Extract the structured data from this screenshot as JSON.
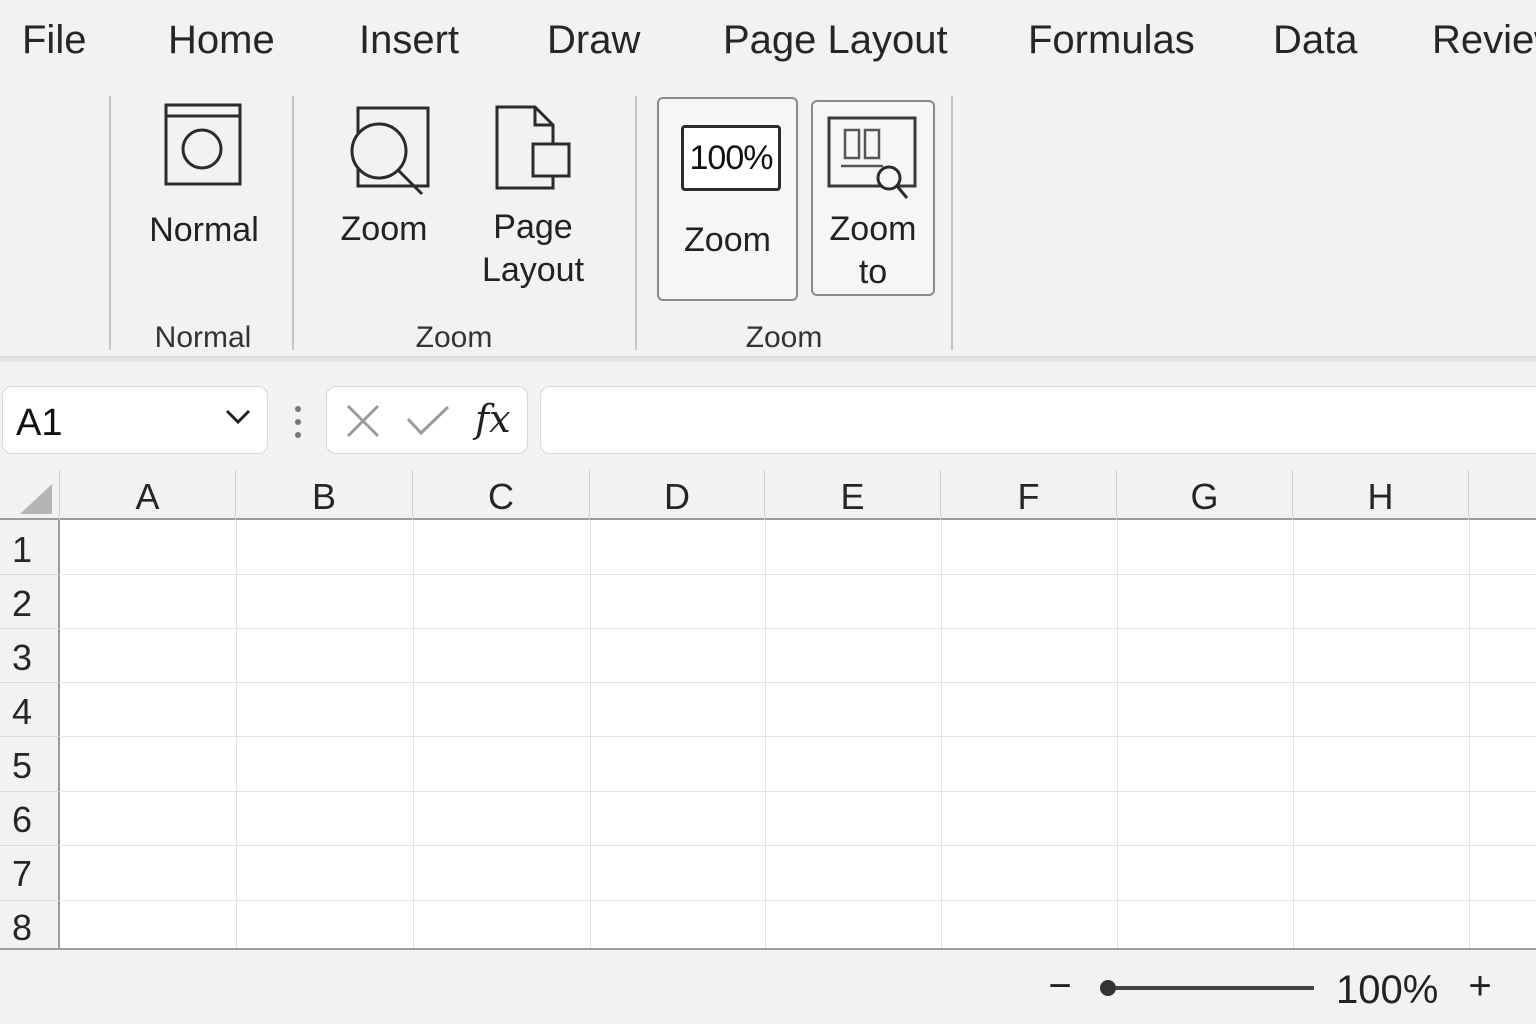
{
  "menu": {
    "tabs": [
      {
        "label": "File"
      },
      {
        "label": "Home"
      },
      {
        "label": "Insert"
      },
      {
        "label": "Draw"
      },
      {
        "label": "Page Layout"
      },
      {
        "label": "Formulas"
      },
      {
        "label": "Data"
      },
      {
        "label": "Review"
      }
    ]
  },
  "ribbon": {
    "normal_group": {
      "label": "Normal",
      "normal_button": {
        "label": "Normal",
        "icon": "normal-view-icon"
      }
    },
    "zoom_group": {
      "label": "Zoom",
      "zoom_button": {
        "label": "Zoom",
        "icon": "magnifier-icon"
      },
      "page_layout_button": {
        "label_line1": "Page",
        "label_line2": "Layout",
        "icon": "page-layout-icon"
      }
    },
    "zoom_group_2": {
      "label": "Zoom",
      "zoom_100_button": {
        "icon_text": "100%",
        "label": "Zoom",
        "icon": "zoom-100-icon"
      },
      "zoom_to_button": {
        "label_line1": "Zoom",
        "label_line2": "to",
        "icon": "zoom-to-selection-icon"
      }
    }
  },
  "formula_bar": {
    "name_box": "A1",
    "fx_label": "fx",
    "formula_value": ""
  },
  "grid": {
    "columns": [
      "A",
      "B",
      "C",
      "D",
      "E",
      "F",
      "G",
      "H"
    ],
    "rows": [
      "1",
      "2",
      "3",
      "4",
      "5",
      "6",
      "7",
      "8"
    ]
  },
  "status_bar": {
    "zoom_minus": "−",
    "zoom_plus": "+",
    "zoom_level": "100%",
    "zoom_fraction": 0.0
  }
}
